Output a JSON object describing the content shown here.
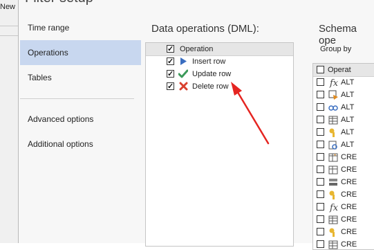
{
  "background": {
    "new_label": "New"
  },
  "dialog": {
    "title": "Filter setup"
  },
  "nav": {
    "items": [
      {
        "label": "Time range",
        "selected": false
      },
      {
        "label": "Operations",
        "selected": true
      },
      {
        "label": "Tables",
        "selected": false
      },
      {
        "label": "Advanced options",
        "selected": false
      },
      {
        "label": "Additional options",
        "selected": false
      }
    ]
  },
  "dml": {
    "title": "Data operations (DML):",
    "header": {
      "label": "Operation",
      "checked": true
    },
    "rows": [
      {
        "label": "Insert row",
        "checked": true,
        "icon": "play-triangle-icon",
        "color": "#3a6ec0"
      },
      {
        "label": "Update row",
        "checked": true,
        "icon": "check-mark-icon",
        "color": "#3c9a5a"
      },
      {
        "label": "Delete row",
        "checked": true,
        "icon": "red-x-icon",
        "color": "#d9402e"
      }
    ]
  },
  "schema": {
    "title": "Schema ope",
    "group_by_label": "Group by",
    "header": {
      "label": "Operat"
    },
    "rows": [
      {
        "label": "ALT",
        "icon": "function-icon"
      },
      {
        "label": "ALT",
        "icon": "trigger-icon"
      },
      {
        "label": "ALT",
        "icon": "link-icon"
      },
      {
        "label": "ALT",
        "icon": "table-icon"
      },
      {
        "label": "ALT",
        "icon": "key-icon"
      },
      {
        "label": "ALT",
        "icon": "view-icon"
      },
      {
        "label": "CRE",
        "icon": "table-create-icon"
      },
      {
        "label": "CRE",
        "icon": "index-icon"
      },
      {
        "label": "CRE",
        "icon": "server-icon"
      },
      {
        "label": "CRE",
        "icon": "key-icon"
      },
      {
        "label": "CRE",
        "icon": "function-icon"
      },
      {
        "label": "CRE",
        "icon": "table-icon"
      },
      {
        "label": "CRE",
        "icon": "key-icon"
      },
      {
        "label": "CRE",
        "icon": "table-icon"
      }
    ]
  },
  "annotation": {
    "arrow_color": "#e52521"
  }
}
